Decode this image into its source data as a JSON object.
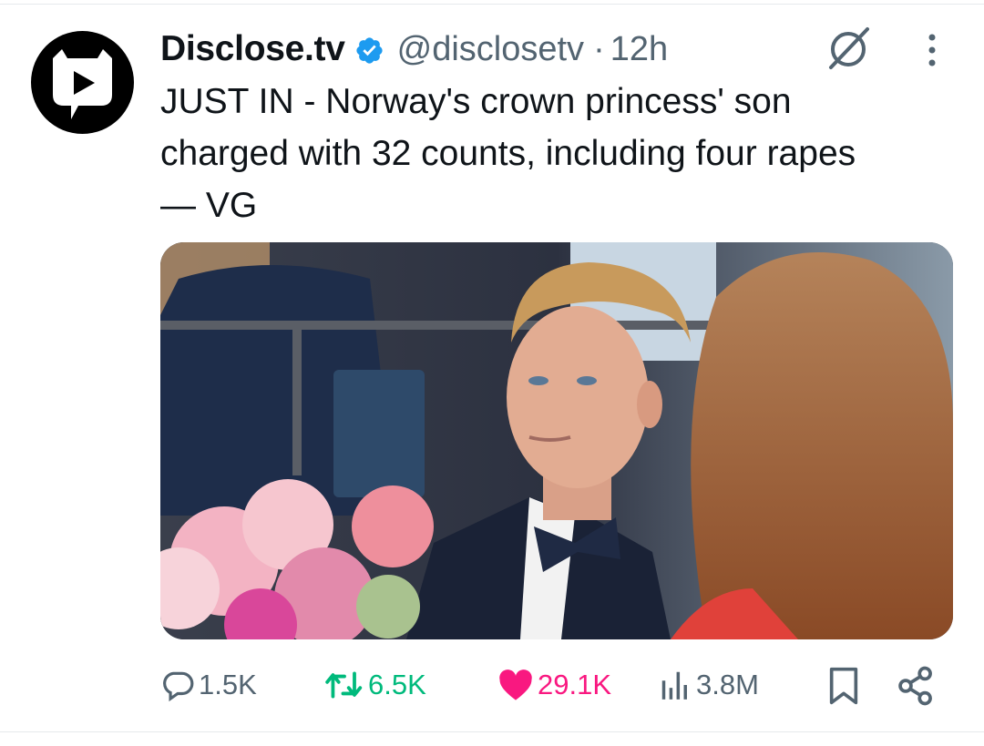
{
  "tweet": {
    "display_name": "Disclose.tv",
    "handle": "@disclosetv",
    "separator": "·",
    "time": "12h",
    "text_lines": [
      "JUST IN - Norway's crown princess' son",
      "charged with 32 counts, including four rapes",
      "— VG"
    ],
    "avatar_icon": "play-speech-bubble-logo",
    "verified_icon": "verified-badge-icon",
    "media": {
      "description_icon": "photo-man-in-tuxedo-bow-tie-with-pink-flowers"
    }
  },
  "actions": {
    "replies": "1.5K",
    "retweets": "6.5K",
    "likes": "29.1K",
    "views": "3.8M"
  },
  "colors": {
    "text_primary": "#0f1419",
    "text_secondary": "#536471",
    "verified_blue": "#1d9bf0",
    "retweet_green": "#00ba7c",
    "like_pink": "#f91880",
    "divider": "#e6e9ec"
  }
}
